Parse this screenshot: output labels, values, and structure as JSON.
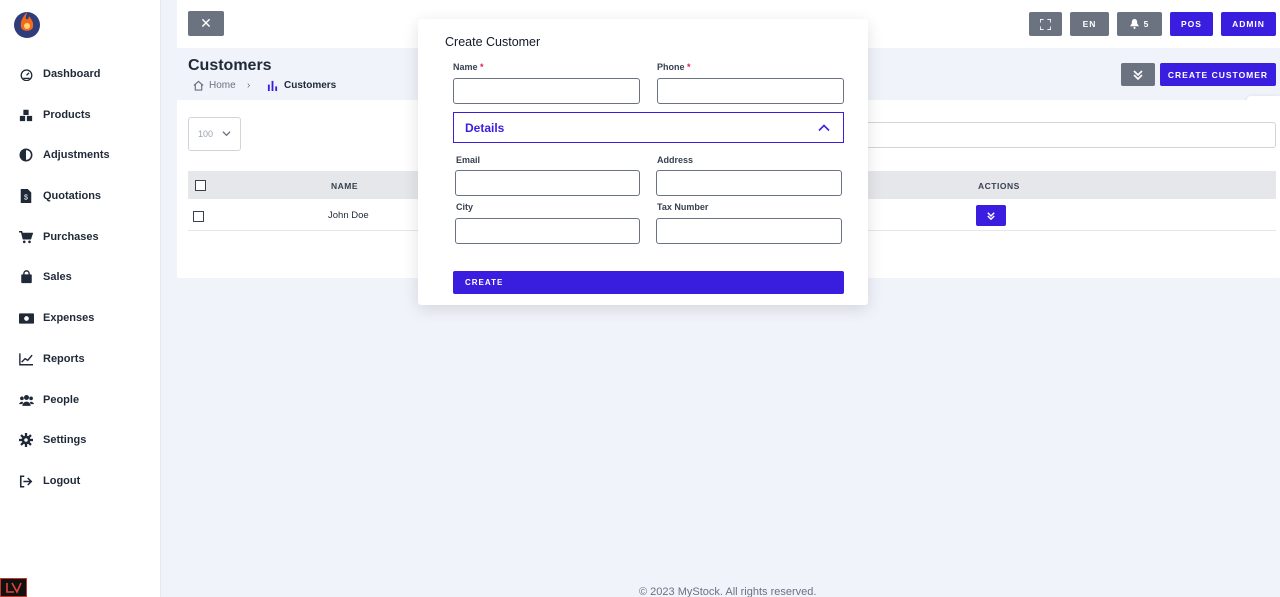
{
  "sidebar": {
    "items": [
      {
        "label": "Dashboard",
        "icon": "dashboard-icon"
      },
      {
        "label": "Products",
        "icon": "products-icon"
      },
      {
        "label": "Adjustments",
        "icon": "adjustments-icon"
      },
      {
        "label": "Quotations",
        "icon": "quotations-icon"
      },
      {
        "label": "Purchases",
        "icon": "cart-icon"
      },
      {
        "label": "Sales",
        "icon": "shopping-bag-icon"
      },
      {
        "label": "Expenses",
        "icon": "money-icon"
      },
      {
        "label": "Reports",
        "icon": "chart-line-icon"
      },
      {
        "label": "People",
        "icon": "users-icon"
      },
      {
        "label": "Settings",
        "icon": "gear-icon"
      },
      {
        "label": "Logout",
        "icon": "logout-icon"
      }
    ]
  },
  "topbar": {
    "lang": "EN",
    "notifications_count": "5",
    "pos_label": "POS",
    "admin_label": "ADMIN"
  },
  "page": {
    "title": "Customers",
    "breadcrumb": {
      "home": "Home",
      "current": "Customers"
    },
    "create_button": "CREATE CUSTOMER"
  },
  "table": {
    "per_page": "100",
    "headers": {
      "name": "NAME",
      "actions": "ACTIONS"
    },
    "rows": [
      {
        "name": "John Doe"
      }
    ]
  },
  "modal": {
    "title": "Create Customer",
    "fields": {
      "name": {
        "label": "Name",
        "required": "*",
        "value": ""
      },
      "phone": {
        "label": "Phone",
        "required": "*",
        "value": ""
      },
      "email": {
        "label": "Email",
        "value": ""
      },
      "address": {
        "label": "Address",
        "value": ""
      },
      "city": {
        "label": "City",
        "value": ""
      },
      "tax_number": {
        "label": "Tax Number",
        "value": ""
      }
    },
    "details_label": "Details",
    "create_label": "CREATE"
  },
  "footer": {
    "text": "© 2023 MyStock. All rights reserved."
  },
  "colors": {
    "accent": "#3a1ee0",
    "gray_button": "#6b7280",
    "background": "#f0f3fa"
  }
}
